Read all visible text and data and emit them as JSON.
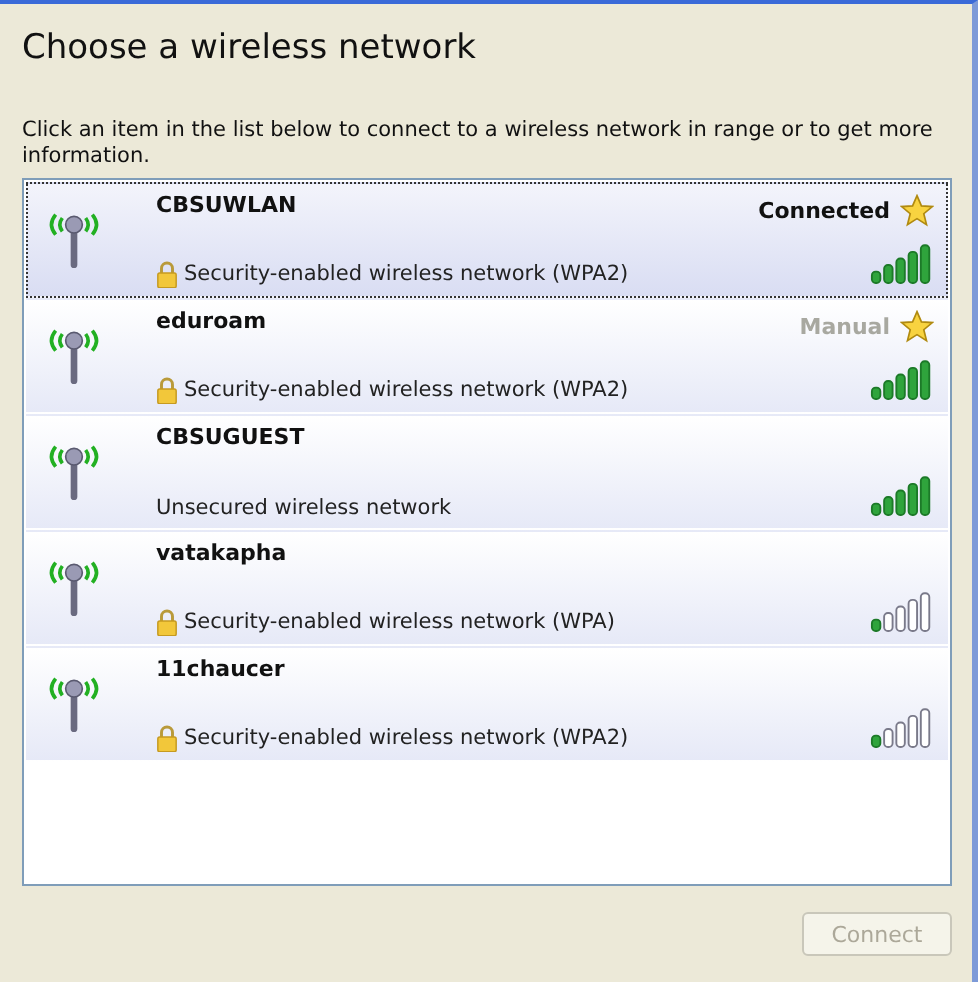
{
  "title": "Choose a wireless network",
  "description": "Click an item in the list below to connect to a wireless network in range or to get more information.",
  "networks": [
    {
      "name": "CBSUWLAN",
      "security": "Security-enabled wireless network (WPA2)",
      "secured": true,
      "status": "Connected",
      "connected": true,
      "favorite": true,
      "weak_signal": false,
      "selected": true
    },
    {
      "name": "eduroam",
      "security": "Security-enabled wireless network (WPA2)",
      "secured": true,
      "status": "Manual",
      "connected": false,
      "favorite": true,
      "weak_signal": false,
      "selected": false
    },
    {
      "name": "CBSUGUEST",
      "security": "Unsecured wireless network",
      "secured": false,
      "favorite": false,
      "weak_signal": false,
      "selected": false
    },
    {
      "name": "vatakapha",
      "security": "Security-enabled wireless network (WPA)",
      "secured": true,
      "favorite": false,
      "weak_signal": true,
      "selected": false
    },
    {
      "name": "11chaucer",
      "security": "Security-enabled wireless network (WPA2)",
      "secured": true,
      "favorite": false,
      "weak_signal": true,
      "selected": false
    }
  ],
  "connect_button": {
    "label": "Connect",
    "disabled": true
  }
}
